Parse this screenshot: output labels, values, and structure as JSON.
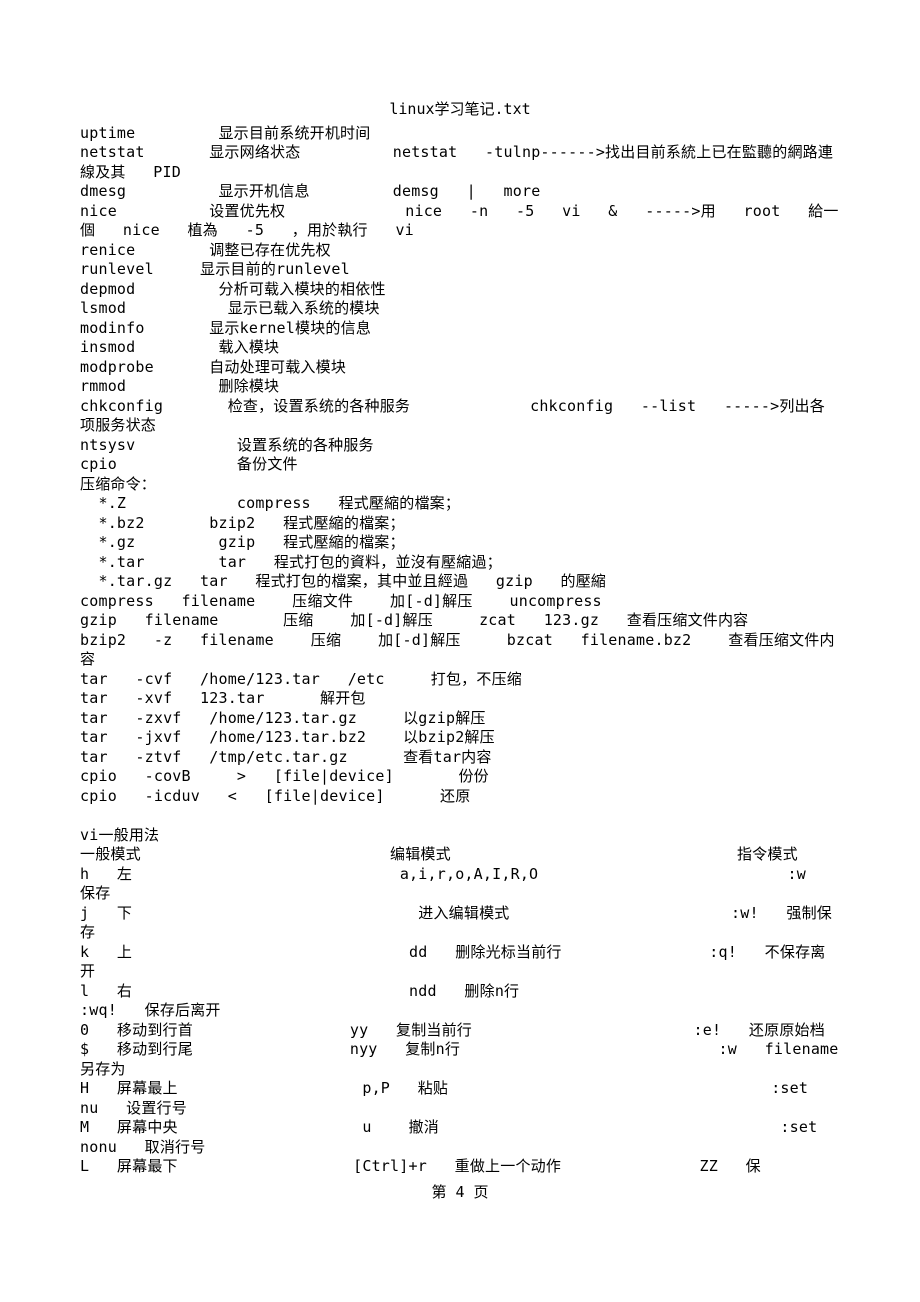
{
  "title": "linux学习笔记.txt",
  "body_lines": [
    "uptime         显示目前系统开机时间",
    "netstat       显示网络状态          netstat   -tulnp------>找出目前系統上已在監聽的網路連線及其   PID",
    "dmesg          显示开机信息         demsg   |   more",
    "nice          设置优先权             nice   -n   -5   vi   &   ----->用   root   給一個   nice   植為   -5   ，用於執行   vi",
    "renice        调整已存在优先权",
    "runlevel     显示目前的runlevel",
    "depmod         分析可载入模块的相依性",
    "lsmod           显示已载入系统的模块",
    "modinfo       显示kernel模块的信息",
    "insmod         载入模块",
    "modprobe      自动处理可载入模块",
    "rmmod          删除模块",
    "chkconfig       检查，设置系统的各种服务             chkconfig   --list   ----->列出各项服务状态",
    "ntsysv           设置系统的各种服务",
    "cpio             备份文件",
    "压缩命令：",
    "  *.Z            compress   程式壓縮的檔案；",
    "  *.bz2       bzip2   程式壓縮的檔案；",
    "  *.gz         gzip   程式壓縮的檔案；",
    "  *.tar        tar   程式打包的資料，並沒有壓縮過；",
    "  *.tar.gz   tar   程式打包的檔案，其中並且經過   gzip   的壓縮",
    "compress   filename    压缩文件    加[-d]解压    uncompress",
    "gzip   filename       压缩    加[-d]解压     zcat   123.gz   查看压缩文件内容",
    "bzip2   -z   filename    压缩    加[-d]解压     bzcat   filename.bz2    查看压缩文件内容",
    "tar   -cvf   /home/123.tar   /etc     打包，不压缩",
    "tar   -xvf   123.tar      解开包",
    "tar   -zxvf   /home/123.tar.gz     以gzip解压",
    "tar   -jxvf   /home/123.tar.bz2    以bzip2解压",
    "tar   -ztvf   /tmp/etc.tar.gz      查看tar内容",
    "cpio   -covB     >   [file|device]       份份",
    "cpio   -icduv   <   [file|device]      还原",
    "",
    "vi一般用法",
    "一般模式                           编辑模式                               指令模式",
    "h   左                             a,i,r,o,A,I,R,O                           :w   保存",
    "j   下                               进入编辑模式                        :w!   强制保存",
    "k   上                              dd   删除光标当前行                :q!   不保存离开",
    "l   右                              ndd   删除n行                                :wq!   保存后离开",
    "0   移动到行首                 yy   复制当前行                        :e!   还原原始档",
    "$   移动到行尾                 nyy   复制n行                            :w   filename   另存为",
    "H   屏幕最上                    p,P   粘贴                                   :set   nu   设置行号",
    "M   屏幕中央                    u    撤消                                     :set   nonu   取消行号",
    "L   屏幕最下                   [Ctrl]+r   重做上一个动作               ZZ   保"
  ],
  "footer": "第 4 页"
}
